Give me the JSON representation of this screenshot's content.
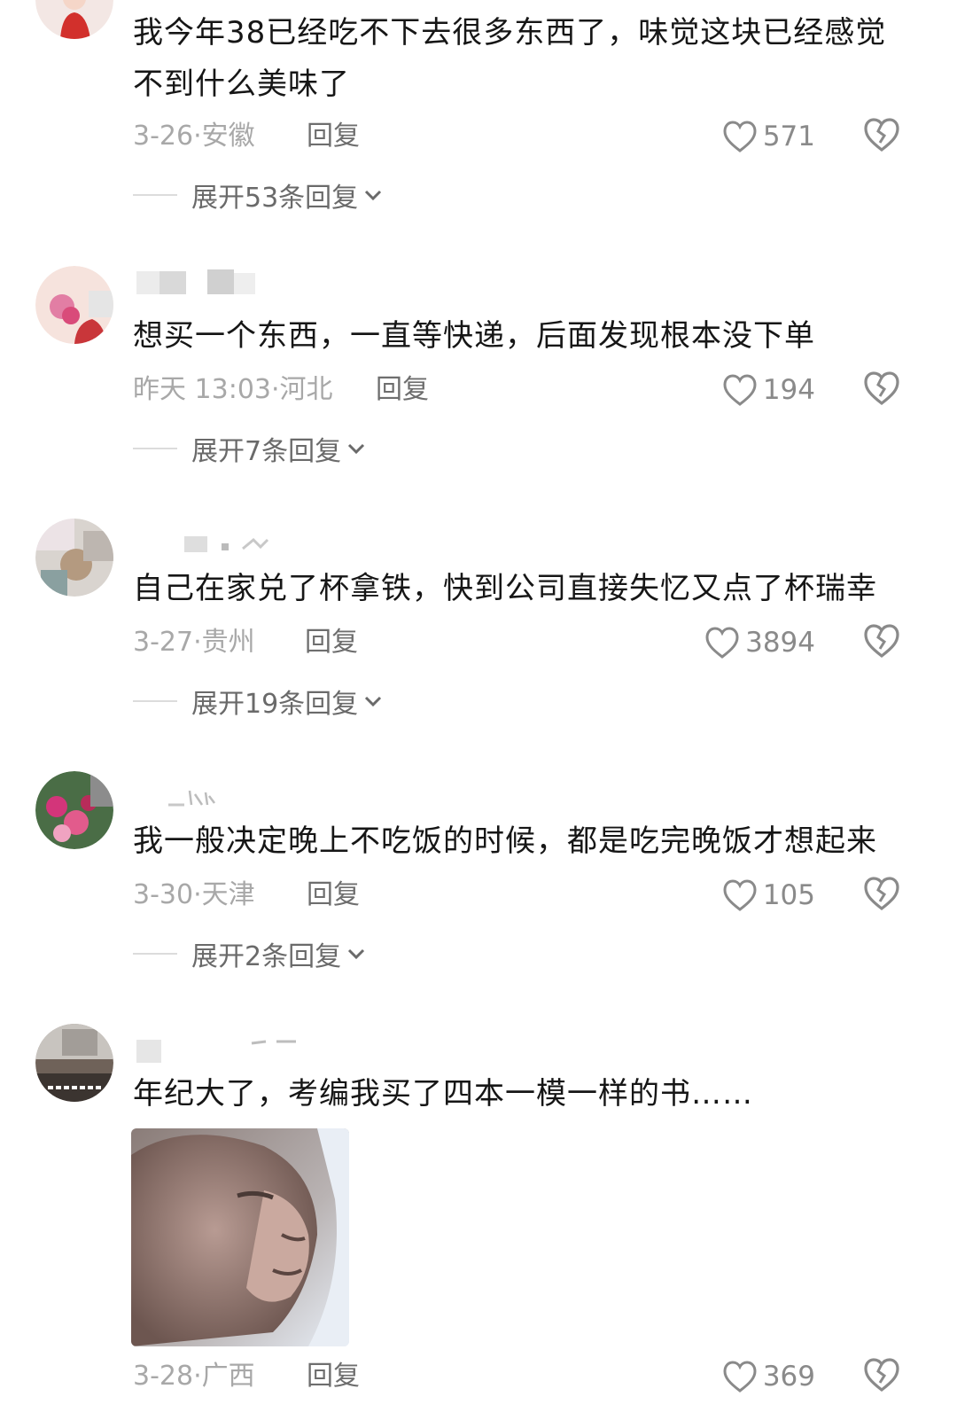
{
  "comments": [
    {
      "text": "我今年38已经吃不下去很多东西了，味觉这块已经感觉不到什么美味了",
      "time": "3-26·安徽",
      "reply": "回复",
      "likes": "571",
      "expand": "展开53条回复"
    },
    {
      "text": "想买一个东西，一直等快递，后面发现根本没下单",
      "time": "昨天 13:03·河北",
      "reply": "回复",
      "likes": "194",
      "expand": "展开7条回复"
    },
    {
      "text": "自己在家兑了杯拿铁，快到公司直接失忆又点了杯瑞幸",
      "time": "3-27·贵州",
      "reply": "回复",
      "likes": "3894",
      "expand": "展开19条回复"
    },
    {
      "text": "我一般决定晚上不吃饭的时候，都是吃完晚饭才想起来",
      "time": "3-30·天津",
      "reply": "回复",
      "likes": "105",
      "expand": "展开2条回复"
    },
    {
      "text": "年纪大了，考编我买了四本一模一样的书……",
      "time": "3-28·广西",
      "reply": "回复",
      "likes": "369"
    }
  ],
  "icons": {
    "like": "heart-outline-icon",
    "dislike": "broken-heart-icon",
    "expand": "chevron-down-icon"
  },
  "colors": {
    "text": "#161616",
    "meta": "#a8a8a8",
    "reply": "#6e6e6e"
  }
}
